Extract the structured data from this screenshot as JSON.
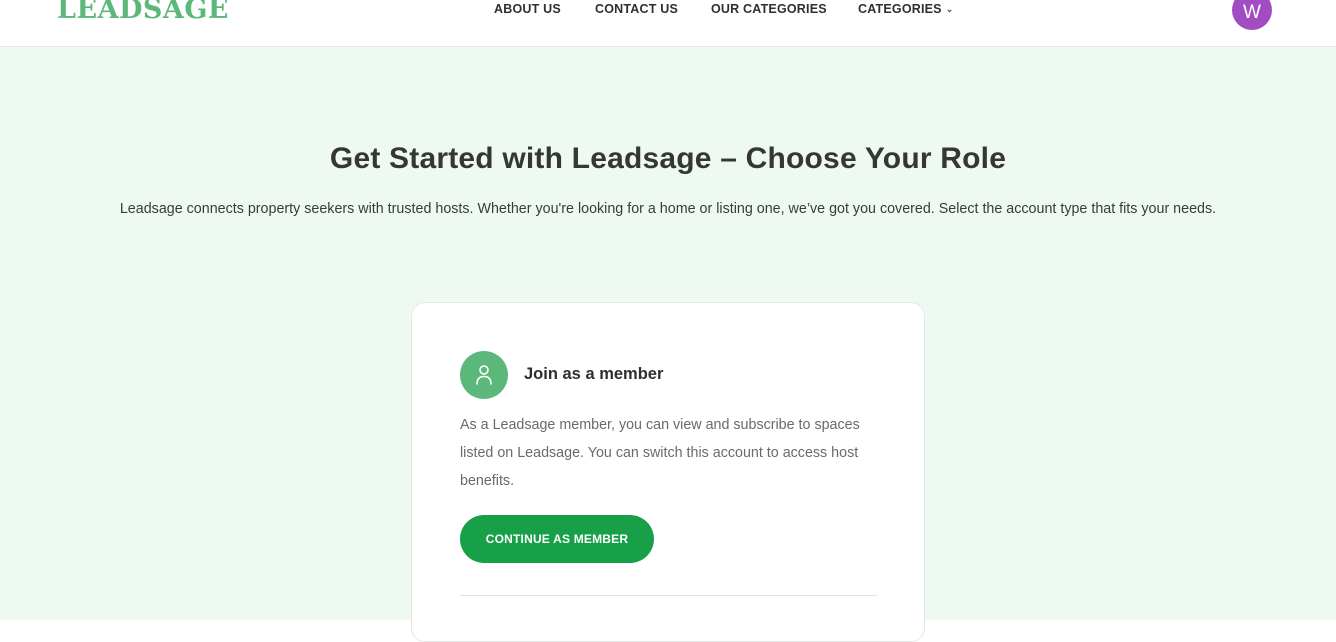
{
  "header": {
    "logo": "LEADSAGE",
    "nav": [
      {
        "label": "ABOUT US"
      },
      {
        "label": "CONTACT US"
      },
      {
        "label": "OUR CATEGORIES"
      },
      {
        "label": "CATEGORIES",
        "has_dropdown": true
      }
    ],
    "avatar_initial": "W"
  },
  "main": {
    "title": "Get Started with Leadsage – Choose Your Role",
    "subtitle": "Leadsage connects property seekers with trusted hosts. Whether you're looking for a home or listing one, we’ve got you covered. Select the account type that fits your needs.",
    "card": {
      "icon": "user-icon",
      "title": "Join as a member",
      "description": "As a Leadsage member, you can view and subscribe to spaces listed on Leadsage. You can switch this account to access host benefits.",
      "button_label": "CONTINUE AS MEMBER"
    }
  },
  "colors": {
    "brand_green": "#5cb87a",
    "button_green": "#18a049",
    "background_mint": "#eefaf1",
    "avatar_purple": "#a24cc2"
  }
}
